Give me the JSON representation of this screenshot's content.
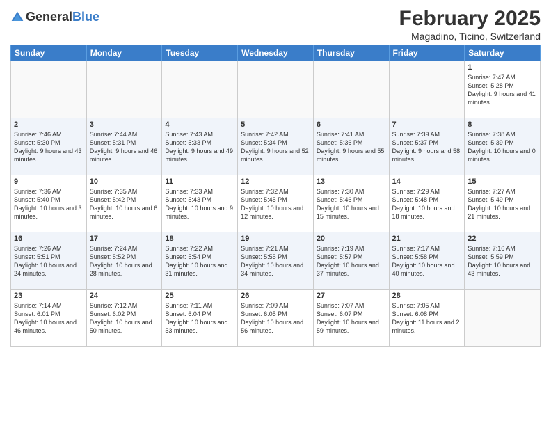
{
  "header": {
    "logo_general": "General",
    "logo_blue": "Blue",
    "month": "February 2025",
    "location": "Magadino, Ticino, Switzerland"
  },
  "days_of_week": [
    "Sunday",
    "Monday",
    "Tuesday",
    "Wednesday",
    "Thursday",
    "Friday",
    "Saturday"
  ],
  "weeks": [
    [
      {
        "day": "",
        "info": ""
      },
      {
        "day": "",
        "info": ""
      },
      {
        "day": "",
        "info": ""
      },
      {
        "day": "",
        "info": ""
      },
      {
        "day": "",
        "info": ""
      },
      {
        "day": "",
        "info": ""
      },
      {
        "day": "1",
        "info": "Sunrise: 7:47 AM\nSunset: 5:28 PM\nDaylight: 9 hours and 41 minutes."
      }
    ],
    [
      {
        "day": "2",
        "info": "Sunrise: 7:46 AM\nSunset: 5:30 PM\nDaylight: 9 hours and 43 minutes."
      },
      {
        "day": "3",
        "info": "Sunrise: 7:44 AM\nSunset: 5:31 PM\nDaylight: 9 hours and 46 minutes."
      },
      {
        "day": "4",
        "info": "Sunrise: 7:43 AM\nSunset: 5:33 PM\nDaylight: 9 hours and 49 minutes."
      },
      {
        "day": "5",
        "info": "Sunrise: 7:42 AM\nSunset: 5:34 PM\nDaylight: 9 hours and 52 minutes."
      },
      {
        "day": "6",
        "info": "Sunrise: 7:41 AM\nSunset: 5:36 PM\nDaylight: 9 hours and 55 minutes."
      },
      {
        "day": "7",
        "info": "Sunrise: 7:39 AM\nSunset: 5:37 PM\nDaylight: 9 hours and 58 minutes."
      },
      {
        "day": "8",
        "info": "Sunrise: 7:38 AM\nSunset: 5:39 PM\nDaylight: 10 hours and 0 minutes."
      }
    ],
    [
      {
        "day": "9",
        "info": "Sunrise: 7:36 AM\nSunset: 5:40 PM\nDaylight: 10 hours and 3 minutes."
      },
      {
        "day": "10",
        "info": "Sunrise: 7:35 AM\nSunset: 5:42 PM\nDaylight: 10 hours and 6 minutes."
      },
      {
        "day": "11",
        "info": "Sunrise: 7:33 AM\nSunset: 5:43 PM\nDaylight: 10 hours and 9 minutes."
      },
      {
        "day": "12",
        "info": "Sunrise: 7:32 AM\nSunset: 5:45 PM\nDaylight: 10 hours and 12 minutes."
      },
      {
        "day": "13",
        "info": "Sunrise: 7:30 AM\nSunset: 5:46 PM\nDaylight: 10 hours and 15 minutes."
      },
      {
        "day": "14",
        "info": "Sunrise: 7:29 AM\nSunset: 5:48 PM\nDaylight: 10 hours and 18 minutes."
      },
      {
        "day": "15",
        "info": "Sunrise: 7:27 AM\nSunset: 5:49 PM\nDaylight: 10 hours and 21 minutes."
      }
    ],
    [
      {
        "day": "16",
        "info": "Sunrise: 7:26 AM\nSunset: 5:51 PM\nDaylight: 10 hours and 24 minutes."
      },
      {
        "day": "17",
        "info": "Sunrise: 7:24 AM\nSunset: 5:52 PM\nDaylight: 10 hours and 28 minutes."
      },
      {
        "day": "18",
        "info": "Sunrise: 7:22 AM\nSunset: 5:54 PM\nDaylight: 10 hours and 31 minutes."
      },
      {
        "day": "19",
        "info": "Sunrise: 7:21 AM\nSunset: 5:55 PM\nDaylight: 10 hours and 34 minutes."
      },
      {
        "day": "20",
        "info": "Sunrise: 7:19 AM\nSunset: 5:57 PM\nDaylight: 10 hours and 37 minutes."
      },
      {
        "day": "21",
        "info": "Sunrise: 7:17 AM\nSunset: 5:58 PM\nDaylight: 10 hours and 40 minutes."
      },
      {
        "day": "22",
        "info": "Sunrise: 7:16 AM\nSunset: 5:59 PM\nDaylight: 10 hours and 43 minutes."
      }
    ],
    [
      {
        "day": "23",
        "info": "Sunrise: 7:14 AM\nSunset: 6:01 PM\nDaylight: 10 hours and 46 minutes."
      },
      {
        "day": "24",
        "info": "Sunrise: 7:12 AM\nSunset: 6:02 PM\nDaylight: 10 hours and 50 minutes."
      },
      {
        "day": "25",
        "info": "Sunrise: 7:11 AM\nSunset: 6:04 PM\nDaylight: 10 hours and 53 minutes."
      },
      {
        "day": "26",
        "info": "Sunrise: 7:09 AM\nSunset: 6:05 PM\nDaylight: 10 hours and 56 minutes."
      },
      {
        "day": "27",
        "info": "Sunrise: 7:07 AM\nSunset: 6:07 PM\nDaylight: 10 hours and 59 minutes."
      },
      {
        "day": "28",
        "info": "Sunrise: 7:05 AM\nSunset: 6:08 PM\nDaylight: 11 hours and 2 minutes."
      },
      {
        "day": "",
        "info": ""
      }
    ]
  ]
}
